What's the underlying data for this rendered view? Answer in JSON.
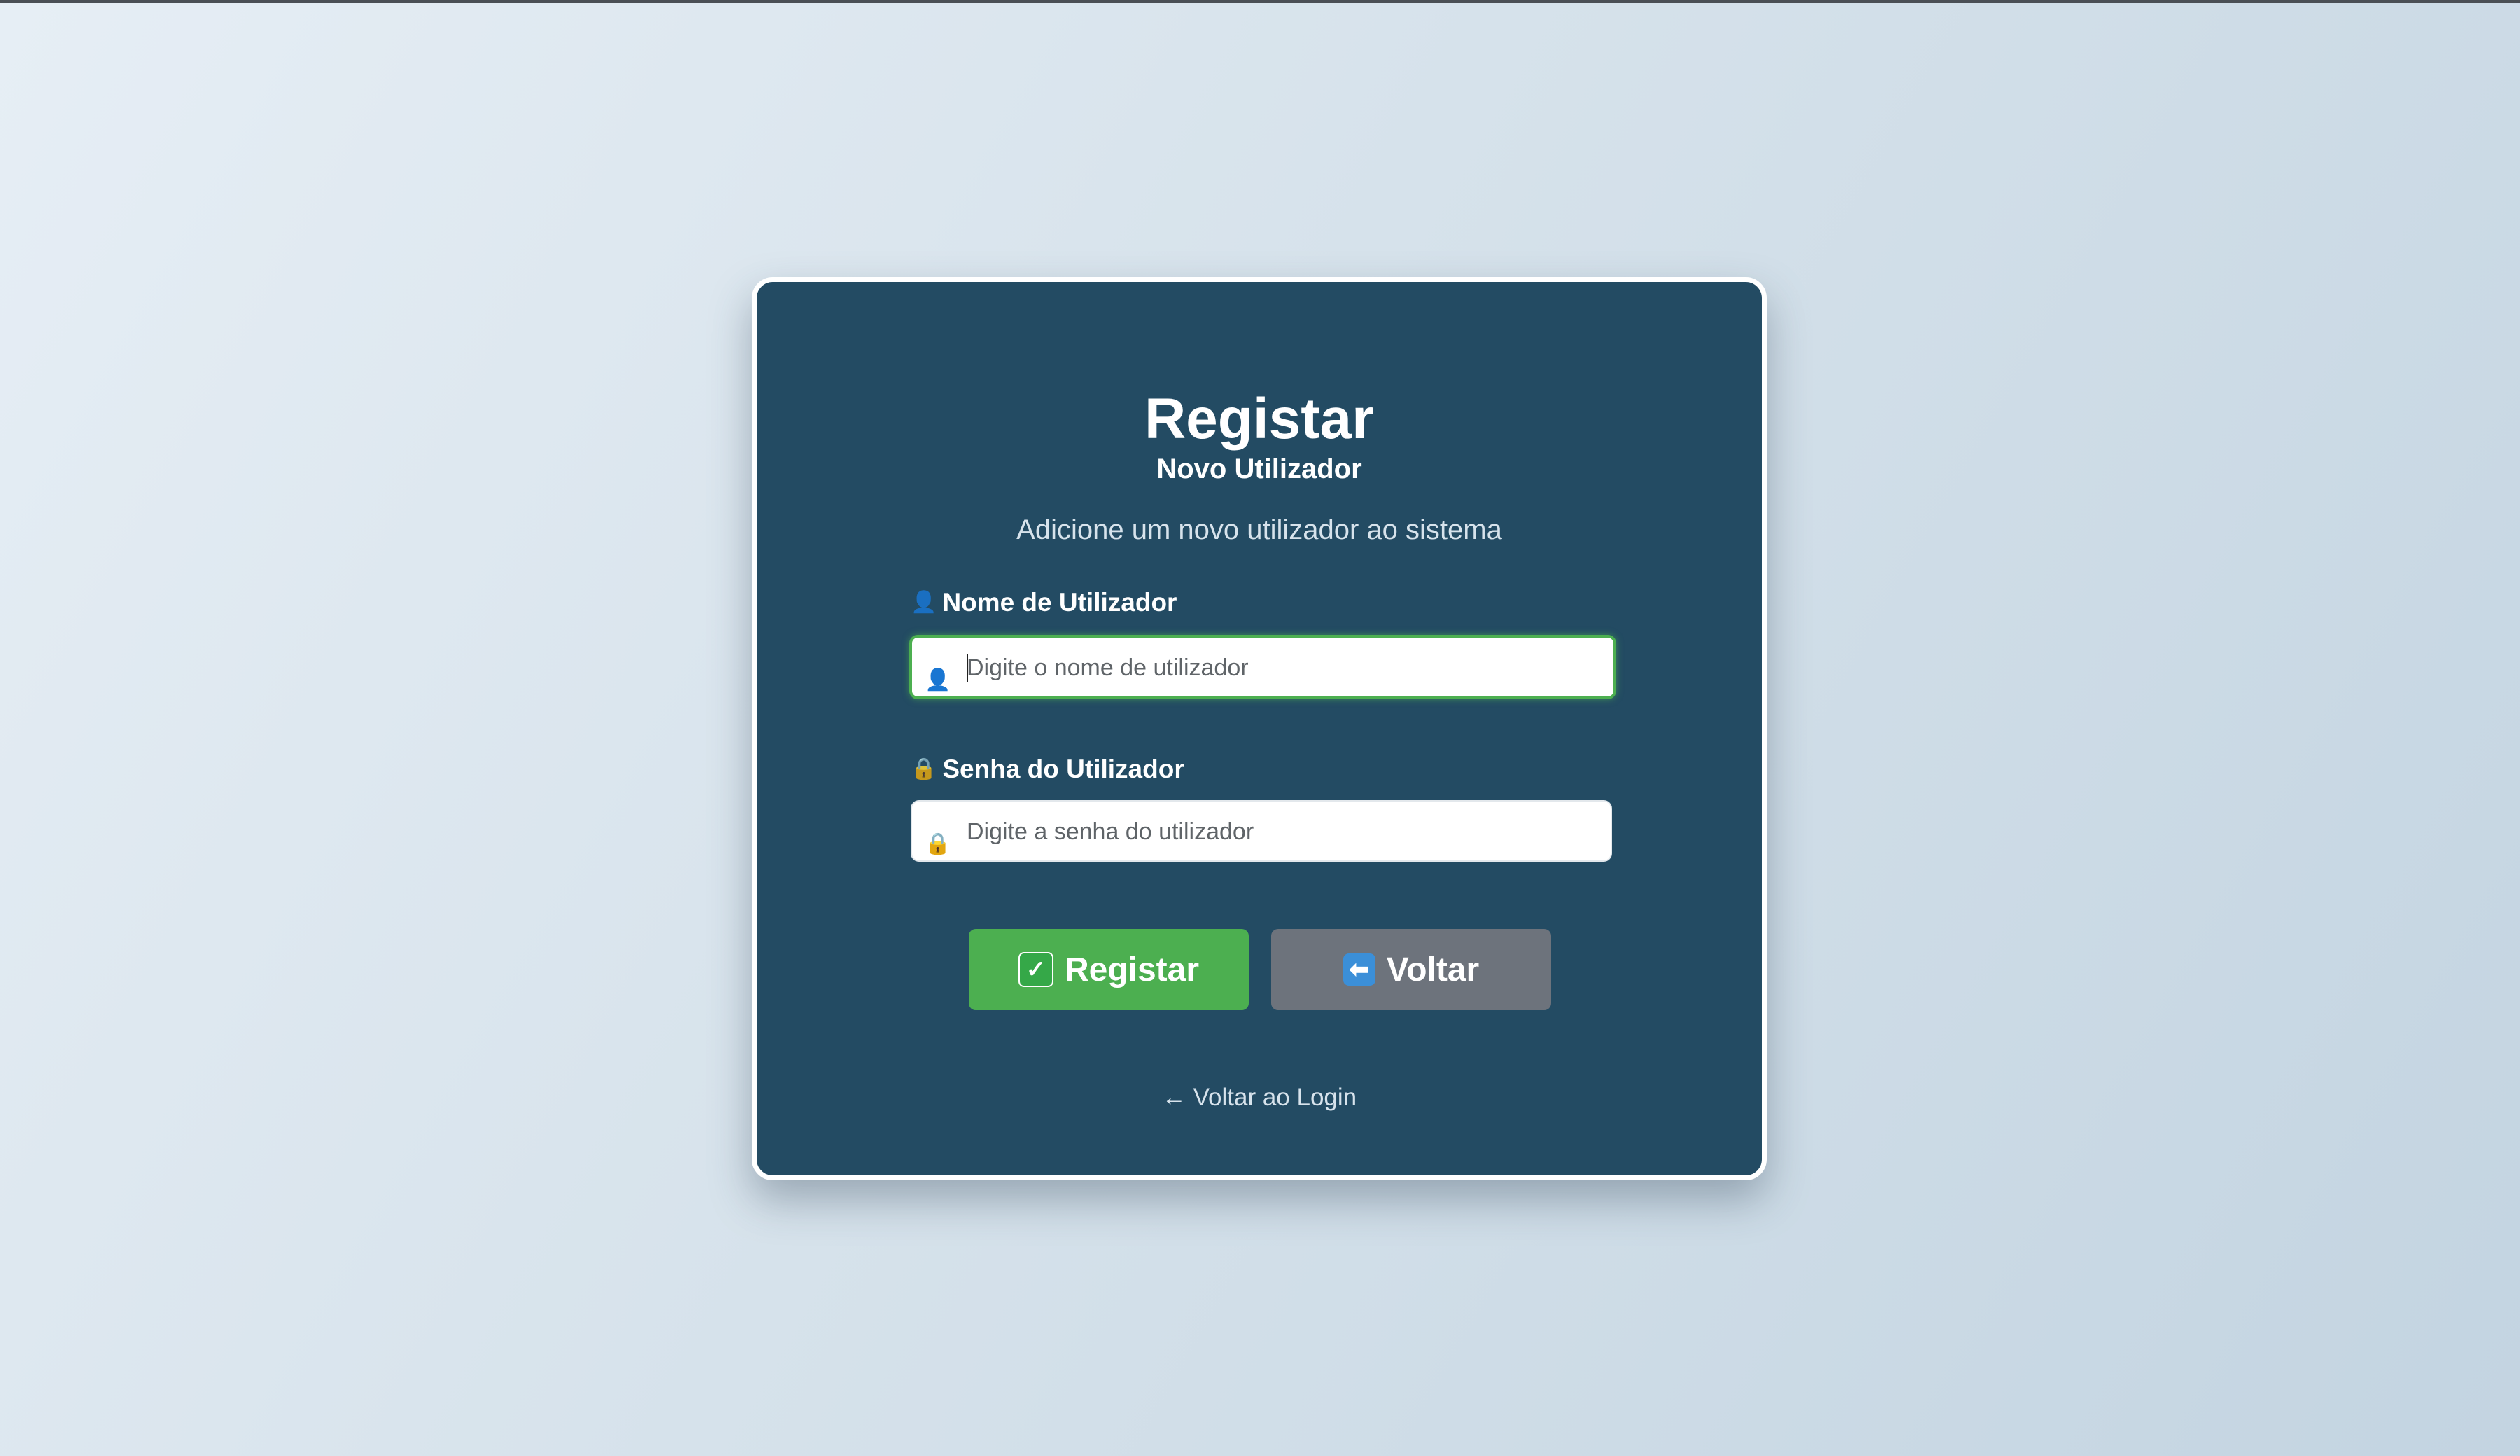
{
  "card": {
    "title": "Registar",
    "subtitle": "Novo Utilizador",
    "description": "Adicione um novo utilizador ao sistema"
  },
  "form": {
    "username": {
      "icon": "user-icon",
      "label": "Nome de Utilizador",
      "placeholder": "Digite o nome de utilizador",
      "value": ""
    },
    "password": {
      "icon": "lock-icon",
      "label": "Senha do Utilizador",
      "placeholder": "Digite a senha do utilizador",
      "value": ""
    }
  },
  "buttons": {
    "register": {
      "icon": "check-icon",
      "label": "Registar"
    },
    "back": {
      "icon": "back-arrow-icon",
      "label": "Voltar"
    }
  },
  "links": {
    "back_to_login": "← Voltar ao Login"
  },
  "colors": {
    "card_bg": "#234b63",
    "accent_green": "#4caf50",
    "secondary_gray": "#6d737c"
  }
}
